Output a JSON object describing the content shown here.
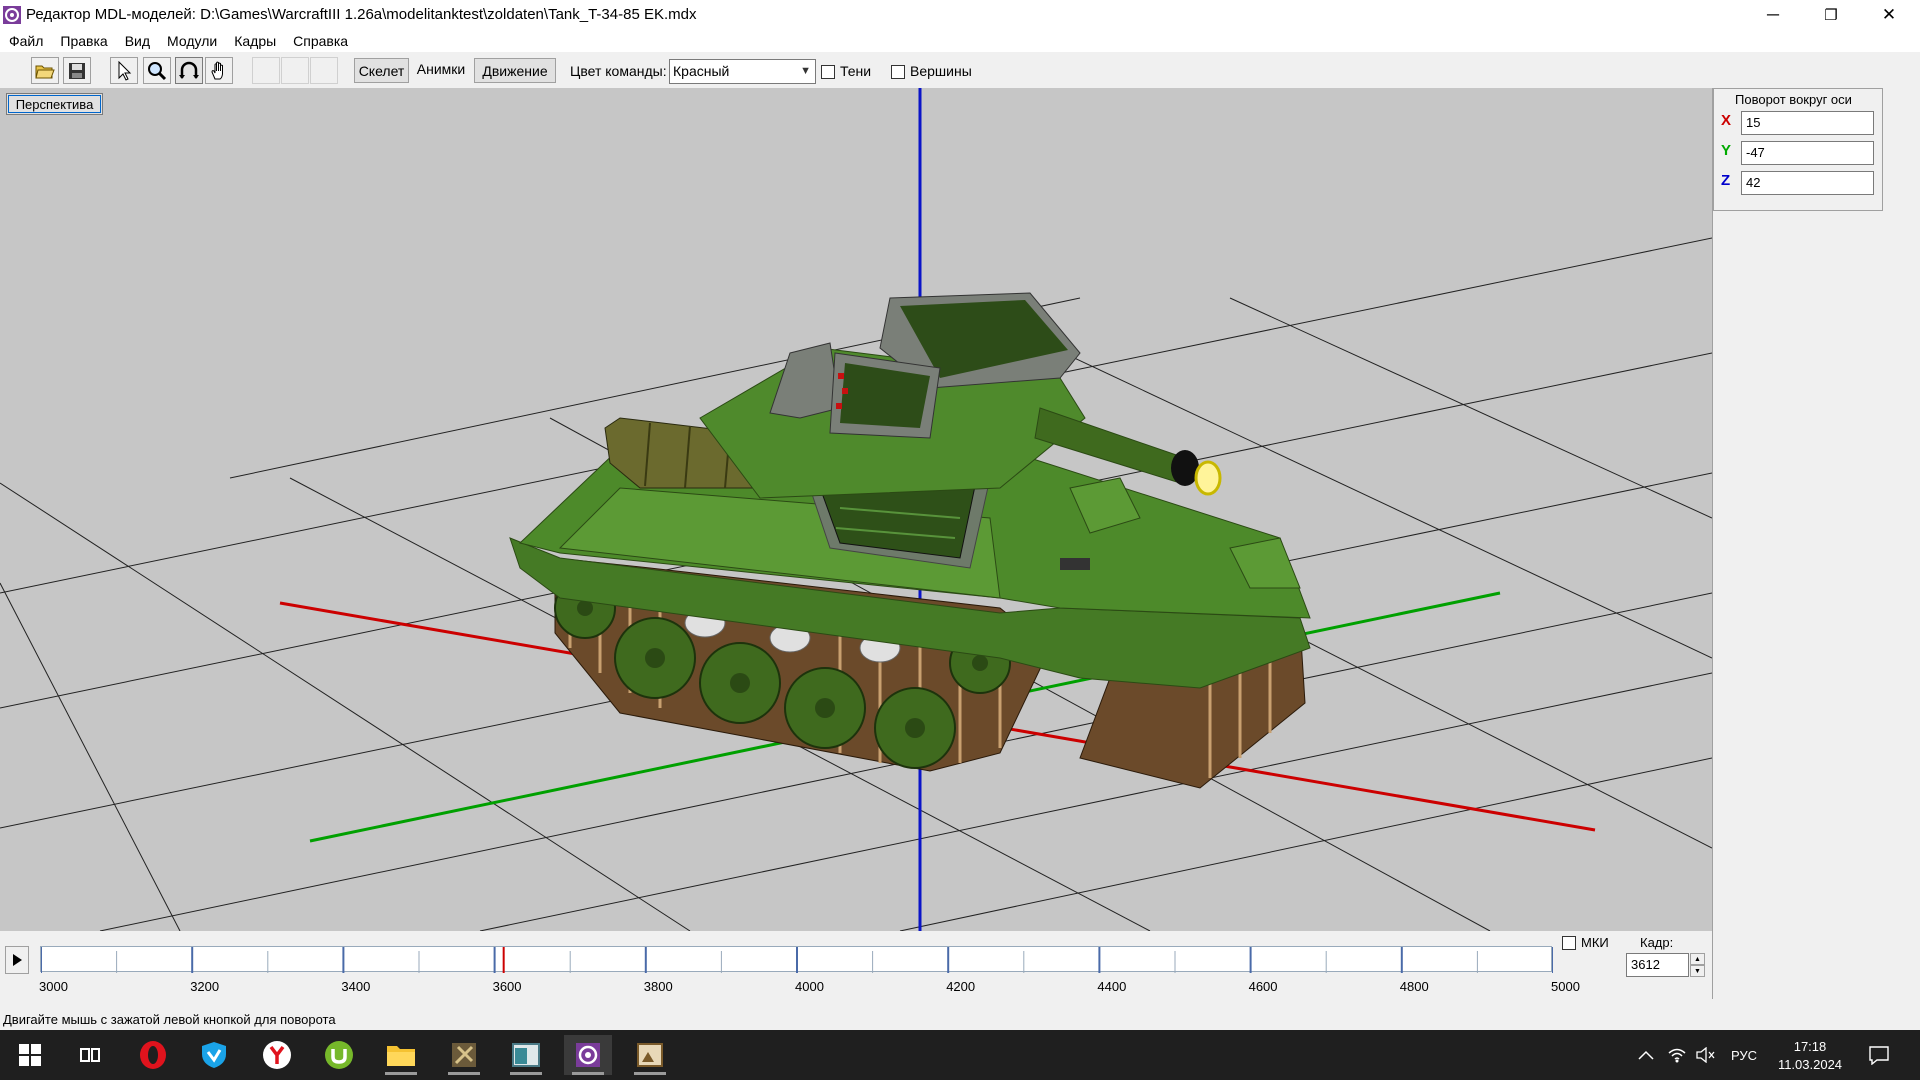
{
  "window": {
    "title": "Редактор MDL-моделей: D:\\Games\\WarcraftIII 1.26a\\modelitanktest\\zoldaten\\Tank_T-34-85 EK.mdx",
    "minimize": "─",
    "maximize": "❐",
    "close": "✕"
  },
  "menu": {
    "file": "Файл",
    "edit": "Правка",
    "view": "Вид",
    "modules": "Модули",
    "frames": "Кадры",
    "help": "Справка"
  },
  "toolbar": {
    "skeleton_tab": "Скелет",
    "anim_tab": "Анимки",
    "motion_tab": "Движение",
    "team_color_label": "Цвет команды:",
    "team_color_value": "Красный",
    "shadows_label": "Тени",
    "shadows_checked": false,
    "vertices_label": "Вершины",
    "vertices_checked": false
  },
  "viewport": {
    "view_label": "Перспектива",
    "background_color": "#c6c6c6",
    "axis_colors": {
      "x": "#cc0000",
      "y": "#00aa00",
      "z": "#0000cc"
    }
  },
  "rotation": {
    "title": "Поворот вокруг оси",
    "x_label": "X",
    "y_label": "Y",
    "z_label": "Z",
    "x_value": "15",
    "y_value": "-47",
    "z_value": "42",
    "x_color": "#cc0000",
    "y_color": "#00aa00",
    "z_color": "#0000cc"
  },
  "timeline": {
    "labels": [
      "3000",
      "3200",
      "3400",
      "3600",
      "3800",
      "4000",
      "4200",
      "4400",
      "4600",
      "4800",
      "5000"
    ],
    "range": [
      3000,
      5000
    ],
    "current_frame": 3612,
    "mki_label": "МКИ",
    "mki_checked": false,
    "frame_label": "Кадр:",
    "frame_value": "3612"
  },
  "status": {
    "text": "Двигайте мышь с зажатой левой кнопкой для поворота"
  },
  "taskbar": {
    "icons": [
      "windows-start-icon",
      "task-view-icon",
      "opera-icon",
      "vpn-shield-icon",
      "yandex-browser-icon",
      "utorrent-icon",
      "file-explorer-icon",
      "warcraft-editor-icon",
      "app-window-icon",
      "mdl-editor-icon",
      "image-viewer-icon"
    ],
    "language": "РУС",
    "time": "17:18",
    "date": "11.03.2024"
  }
}
